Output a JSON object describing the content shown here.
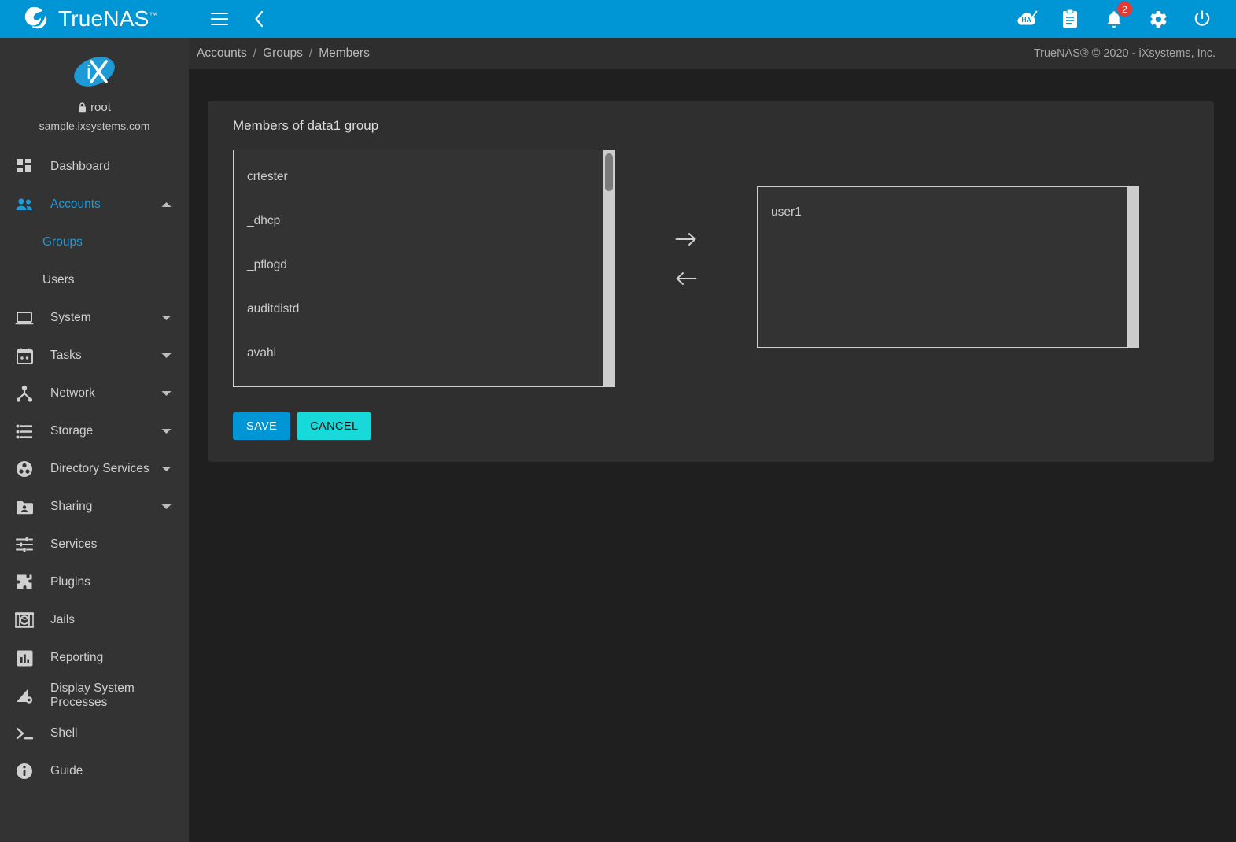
{
  "topbar": {
    "brand_name": "TrueNAS",
    "brand_tm": "™",
    "menu_icon": "hamburger-menu-icon",
    "back_icon": "chevron-left-icon",
    "right_icons": [
      {
        "name": "ha-status-icon",
        "label": "HA"
      },
      {
        "name": "task-manager-icon",
        "label": ""
      },
      {
        "name": "notifications-bell-icon",
        "label": "",
        "badge": "2"
      },
      {
        "name": "settings-gear-icon",
        "label": ""
      },
      {
        "name": "power-icon",
        "label": ""
      }
    ],
    "notification_count": "2"
  },
  "sidebar": {
    "logo_alt": "iX",
    "username": "root",
    "hostname": "sample.ixsystems.com",
    "lock_icon": "lock-icon",
    "items": [
      {
        "label": "Dashboard",
        "icon": "dashboard-icon",
        "expandable": false,
        "active": false
      },
      {
        "label": "Accounts",
        "icon": "accounts-people-icon",
        "expandable": true,
        "active": true,
        "caret": "caret-up-icon"
      },
      {
        "label": "System",
        "icon": "system-laptop-icon",
        "expandable": true,
        "active": false,
        "caret": "caret-down-icon"
      },
      {
        "label": "Tasks",
        "icon": "tasks-calendar-icon",
        "expandable": true,
        "active": false,
        "caret": "caret-down-icon"
      },
      {
        "label": "Network",
        "icon": "network-icon",
        "expandable": true,
        "active": false,
        "caret": "caret-down-icon"
      },
      {
        "label": "Storage",
        "icon": "storage-icon",
        "expandable": true,
        "active": false,
        "caret": "caret-down-icon"
      },
      {
        "label": "Directory Services",
        "icon": "directory-services-icon",
        "expandable": true,
        "active": false,
        "caret": "caret-down-icon"
      },
      {
        "label": "Sharing",
        "icon": "sharing-folder-icon",
        "expandable": true,
        "active": false,
        "caret": "caret-down-icon"
      },
      {
        "label": "Services",
        "icon": "services-sliders-icon",
        "expandable": false,
        "active": false
      },
      {
        "label": "Plugins",
        "icon": "plugins-puzzle-icon",
        "expandable": false,
        "active": false
      },
      {
        "label": "Jails",
        "icon": "jails-icon",
        "expandable": false,
        "active": false
      },
      {
        "label": "Reporting",
        "icon": "reporting-chart-icon",
        "expandable": false,
        "active": false
      },
      {
        "label": "Display System Processes",
        "icon": "system-processes-icon",
        "expandable": false,
        "active": false
      },
      {
        "label": "Shell",
        "icon": "shell-terminal-icon",
        "expandable": false,
        "active": false
      },
      {
        "label": "Guide",
        "icon": "guide-info-icon",
        "expandable": false,
        "active": false
      }
    ],
    "subitems": {
      "accounts": [
        {
          "label": "Groups",
          "active": true
        },
        {
          "label": "Users",
          "active": false
        }
      ]
    }
  },
  "breadcrumb": {
    "items": [
      "Accounts",
      "Groups",
      "Members"
    ],
    "separator": "/",
    "copyright": "TrueNAS® © 2020 - iXsystems, Inc."
  },
  "main": {
    "card_title": "Members of data1 group",
    "available_list": {
      "name": "available-users-list",
      "options": [
        "crtester",
        "_dhcp",
        "_pflogd",
        "auditdistd",
        "avahi"
      ]
    },
    "selected_list": {
      "name": "member-users-list",
      "options": [
        "user1"
      ]
    },
    "move_right_icon": "arrow-right-icon",
    "move_left_icon": "arrow-left-icon",
    "buttons": {
      "save": "SAVE",
      "cancel": "CANCEL"
    }
  },
  "colors": {
    "accent_blue": "#0095d5",
    "accent_cyan": "#18d9d9",
    "sidebar_bg": "#333333",
    "content_bg": "#1f1f1f",
    "card_bg": "#2f2f2f",
    "badge_red": "#e53935",
    "link_blue": "#1e9ad6"
  }
}
